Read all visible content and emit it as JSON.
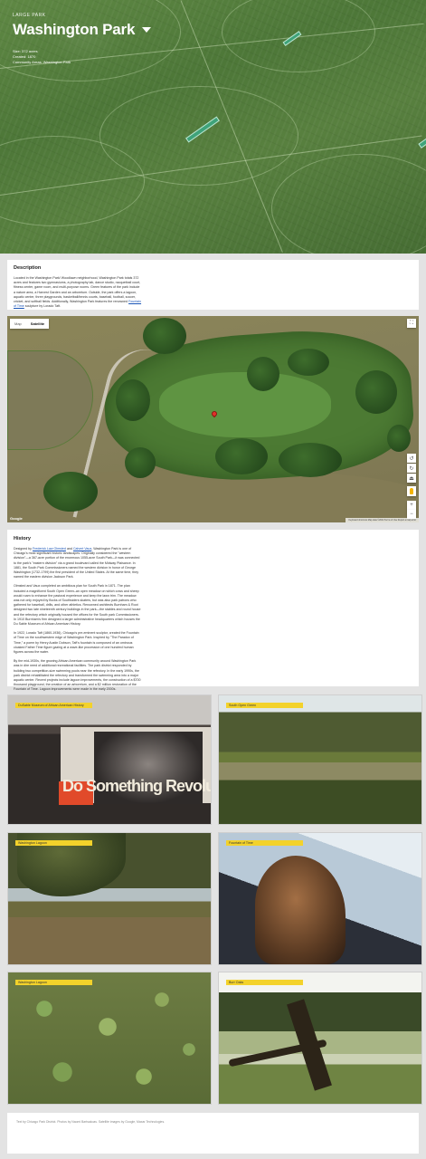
{
  "hero": {
    "eyebrow": "LARGE PARK",
    "title": "Washington Park",
    "meta_acres": "Size: 372 acres",
    "meta_created": "Created: 1870",
    "meta_area": "Community Areas: Washington Park"
  },
  "description": {
    "heading": "Description",
    "text": "Located in the Washington Park/ Woodlawn neighborhood, Washington Park totals 372 acres and features two gymnasiums, a photography lab, dance studio, racquetball court, fitness center, game room, and multi-purpose rooms. Green features of the park include a nature area, a Harvest Garden and an arboretum. Outside, the park offers a lagoon, aquatic center, three playgrounds, basketball/tennis courts, baseball, football, soccer, cricket, and softball fields. Additionally, Washington Park features the renowned",
    "link_text": "Fountain of Time",
    "text_end": "sculpture by Lorado Taft."
  },
  "map": {
    "tab_map": "Map",
    "tab_satellite": "Satellite",
    "active_tab": "Satellite",
    "google": "Google",
    "attribution": "Keyboard shortcuts   Map data ©2024   Terms of Use   Report a map error",
    "fullscreen_icon": "fullscreen-icon",
    "zoom_in": "+",
    "zoom_out": "−"
  },
  "history": {
    "heading": "History",
    "p1_a": "Designed by",
    "p1_link1": "Frederick Law Olmsted",
    "p1_b": "and",
    "p1_link2": "Calvert Vaux",
    "p1_c": ", Washington Park is one of Chicago's most significant historic landscapes. Originally considered the \"western division\"—a 367-acre portion of the enormous 1055-acre South Park—it was connected to the park's \"eastern division\" via a grand boulevard called the Midway Plaisance. In 1881, the South Park Commissioners named the western division in honor of George Washington (1732-1799) the first president of the United States. At the same time, they named the eastern division Jackson Park.",
    "p2": "Olmsted and Vaux completed an ambitious plan for South Park in 1871. The plan included a magnificent South Open Green–an open meadow on which cows and sheep would roam to enhance the pastoral experience and keep the lawn trim. The meadow was not only enjoyed by flocks of Southsiders skaters, but was also park patrons who gathered for baseball, drills, and other athletics. Renowned architects Burnham & Root designed two late nineteenth century buildings in the park—the stables and round house and the refectory which originally housed the offices for the South park Commissioners. In 1910 Burnham's firm designed a larger administrative headquarters which houses the Du Sable Museum of African American History.",
    "p3": "In 1922, Lorado Taft (1860-1936), Chicago's pre-eminent sculptor, created the Fountain of Time on the southwestern edge of Washington Park. Inspired by \"The Paradox of Time,\" a poem by Henry Austin Dobson, Taft's fountain is composed of an ominous cloaked Father Time figure gazing at a wave-like procession of one hundred human figures across the water.",
    "p4": "By the mid-1930s, the growing African American community around Washington Park was in dire need of additional recreational facilities. The park district responded by building two competition-size swimming pools near the refectory. In the early 1990s, the park district rehabilitated the refectory and transformed the swimming area into a major aquatic center. Recent projects include lagoon improvements, the construction of a $700 thousand playground, the creation of an arboretum, and a $2 million restoration of the Fountain of Time. Lagoon improvements were made in the early 2000s."
  },
  "photos": [
    {
      "label": "DuSable Museum of African American History"
    },
    {
      "label": "South Open Green"
    },
    {
      "label": "Washington Lagoon"
    },
    {
      "label": "Fountain of Time"
    },
    {
      "label": "Washington Lagoon"
    },
    {
      "label": "Burr Oaks"
    }
  ],
  "mural_text": "Do Something Revolutionary",
  "footer": {
    "text": "Text by Chicago Park District. Photos by Naomi Bartsakoas. Satellite images by Google, Maxar Technologies."
  },
  "colors": {
    "label_yellow": "#f3d22b",
    "link_blue": "#1a55b7",
    "map_pin": "#e2302a"
  }
}
